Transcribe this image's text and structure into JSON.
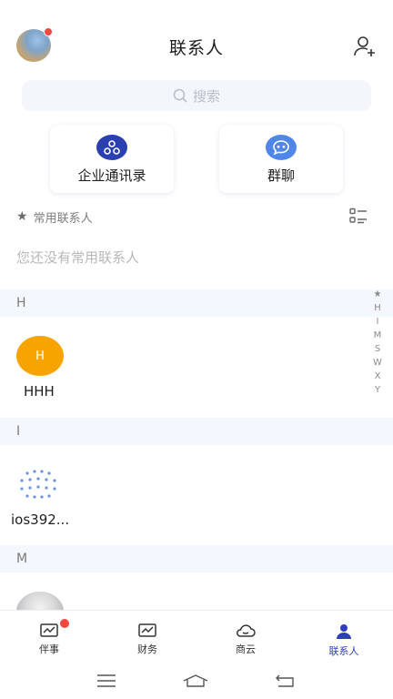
{
  "header": {
    "title": "联系人"
  },
  "search": {
    "placeholder": "搜索"
  },
  "quick_cards": [
    {
      "label": "企业通讯录",
      "icon": "org-structure-icon",
      "color": "#2c3fb0"
    },
    {
      "label": "群聊",
      "icon": "chat-bubble-icon",
      "color": "#4f86e8"
    }
  ],
  "favorites": {
    "label": "常用联系人",
    "empty_text": "您还没有常用联系人"
  },
  "sections": [
    {
      "letter": "H",
      "contacts": [
        {
          "name": "HHH",
          "initial": "H",
          "avatar_color": "#f7a400"
        }
      ]
    },
    {
      "letter": "I",
      "contacts": [
        {
          "name": "ios392..."
        }
      ]
    },
    {
      "letter": "M",
      "contacts": [
        {
          "name": ""
        }
      ]
    }
  ],
  "index_letters": [
    "★",
    "H",
    "I",
    "M",
    "S",
    "W",
    "X",
    "Y"
  ],
  "tabs": [
    {
      "label": "伴事",
      "icon": "trend-chart-icon",
      "badge": true,
      "active": false
    },
    {
      "label": "财务",
      "icon": "trend-chart-icon",
      "badge": false,
      "active": false
    },
    {
      "label": "商云",
      "icon": "cloud-icon",
      "badge": false,
      "active": false
    },
    {
      "label": "联系人",
      "icon": "person-icon",
      "badge": false,
      "active": true
    }
  ],
  "colors": {
    "accent": "#2f3fb8",
    "badge": "#f04a3e",
    "section_bg": "#f4f7fd"
  }
}
